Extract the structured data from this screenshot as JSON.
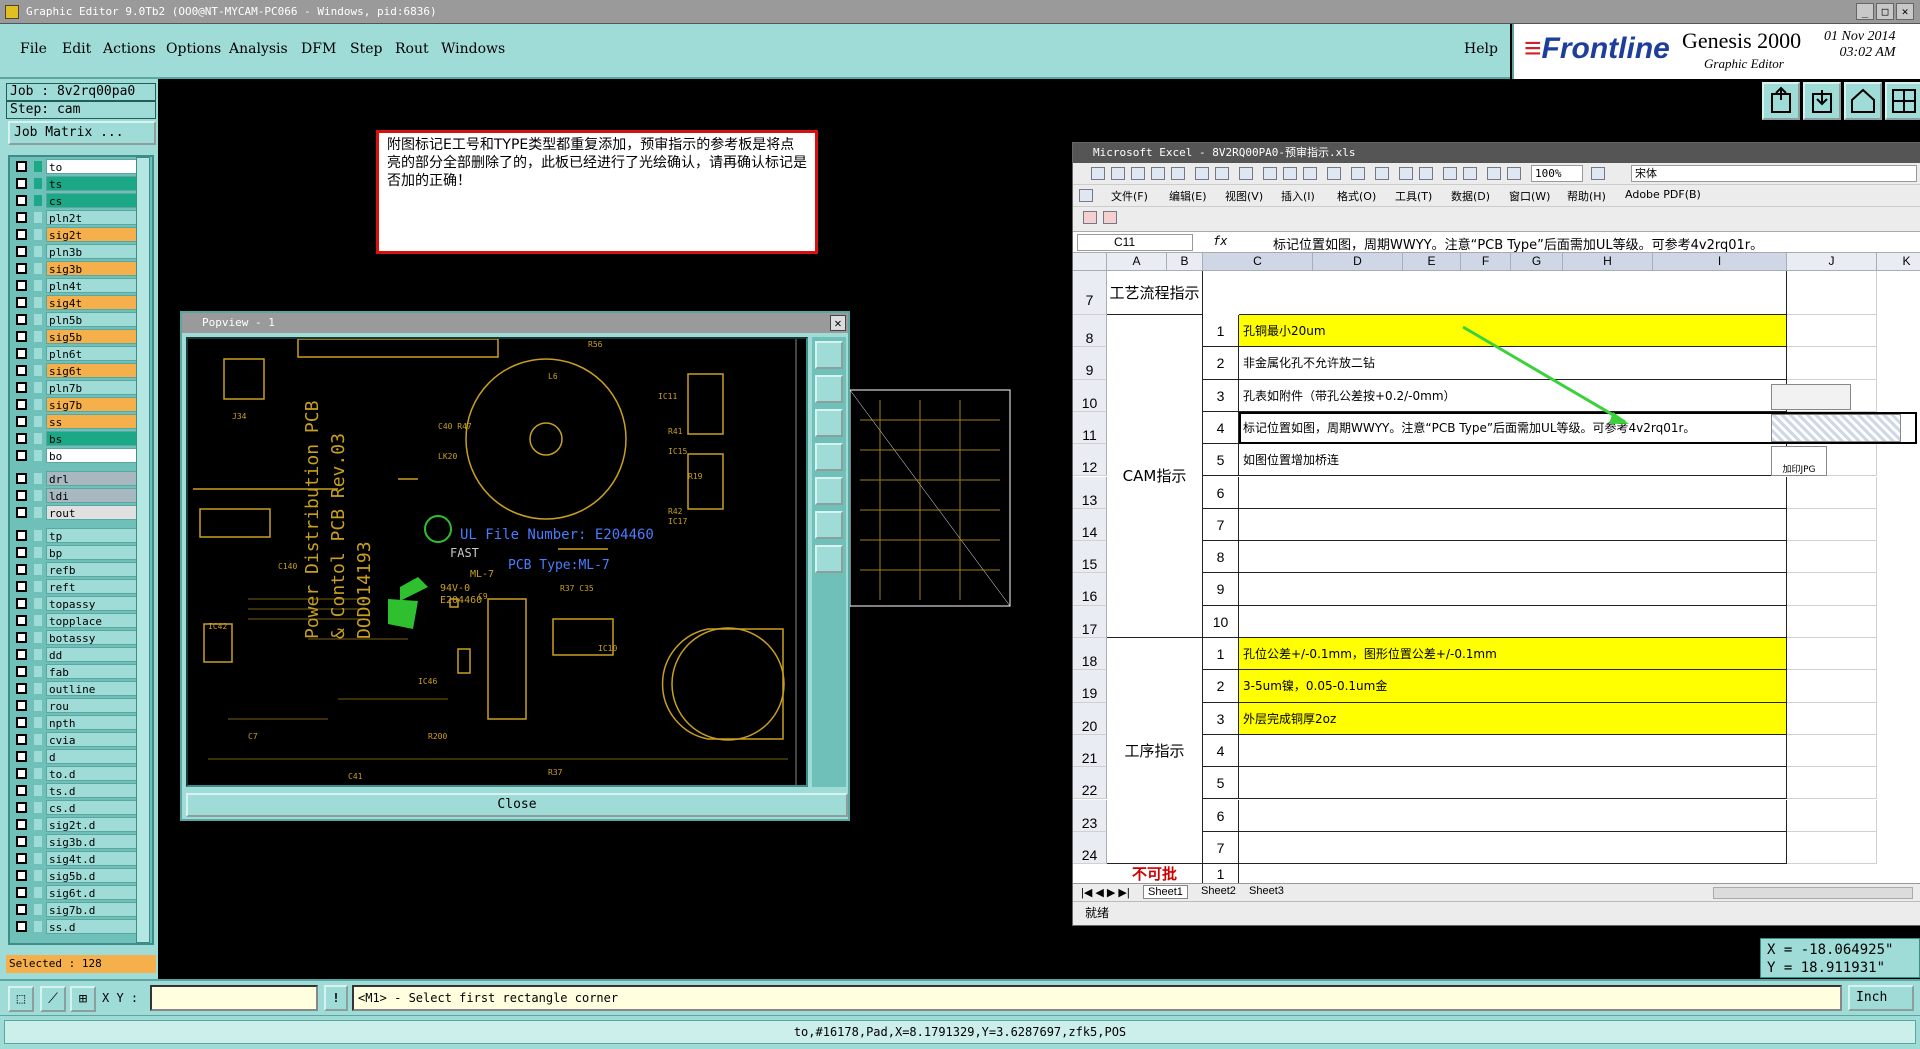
{
  "window": {
    "title": "Graphic Editor 9.0Tb2 (OO0@NT-MYCAM-PC066 - Windows, pid:6836)"
  },
  "menu": {
    "items": [
      "File",
      "Edit",
      "Actions",
      "Options",
      "Analysis",
      "DFM",
      "Step",
      "Rout",
      "Windows"
    ],
    "help": "Help"
  },
  "brand": {
    "logo": "Frontline",
    "product": "Genesis 2000",
    "subtitle": "Graphic Editor",
    "date": "01 Nov 2014",
    "time": "03:02 AM"
  },
  "job": {
    "job_label": "Job : 8v2rq00pa0",
    "step_label": "Step: cam",
    "matrix_button": "Job Matrix ..."
  },
  "layers": [
    {
      "name": "to",
      "color": "#ffffff"
    },
    {
      "name": "ts",
      "color": "#1aa887"
    },
    {
      "name": "cs",
      "color": "#1aa887"
    },
    {
      "name": "pln2t",
      "color": "#9fdcd7"
    },
    {
      "name": "sig2t",
      "color": "#f5b04c"
    },
    {
      "name": "pln3b",
      "color": "#9fdcd7"
    },
    {
      "name": "sig3b",
      "color": "#f5b04c"
    },
    {
      "name": "pln4t",
      "color": "#9fdcd7"
    },
    {
      "name": "sig4t",
      "color": "#f5b04c"
    },
    {
      "name": "pln5b",
      "color": "#9fdcd7"
    },
    {
      "name": "sig5b",
      "color": "#f5b04c"
    },
    {
      "name": "pln6t",
      "color": "#9fdcd7"
    },
    {
      "name": "sig6t",
      "color": "#f5b04c"
    },
    {
      "name": "pln7b",
      "color": "#9fdcd7"
    },
    {
      "name": "sig7b",
      "color": "#f5b04c"
    },
    {
      "name": "ss",
      "color": "#f5b04c"
    },
    {
      "name": "bs",
      "color": "#1aa887"
    },
    {
      "name": "bo",
      "color": "#ffffff"
    },
    {
      "name": "drl",
      "color": "#a9b8c0"
    },
    {
      "name": "ldi",
      "color": "#a9b8c0"
    },
    {
      "name": "rout",
      "color": "#e0e0e0"
    },
    {
      "name": "tp",
      "color": "#9fdcd7"
    },
    {
      "name": "bp",
      "color": "#9fdcd7"
    },
    {
      "name": "refb",
      "color": "#9fdcd7"
    },
    {
      "name": "reft",
      "color": "#9fdcd7"
    },
    {
      "name": "topassy",
      "color": "#9fdcd7"
    },
    {
      "name": "topplace",
      "color": "#9fdcd7"
    },
    {
      "name": "botassy",
      "color": "#9fdcd7"
    },
    {
      "name": "dd",
      "color": "#9fdcd7"
    },
    {
      "name": "fab",
      "color": "#9fdcd7"
    },
    {
      "name": "outline",
      "color": "#9fdcd7"
    },
    {
      "name": "rou",
      "color": "#9fdcd7"
    },
    {
      "name": "npth",
      "color": "#9fdcd7"
    },
    {
      "name": "cvia",
      "color": "#9fdcd7"
    },
    {
      "name": "d",
      "color": "#9fdcd7"
    },
    {
      "name": "to.d",
      "color": "#9fdcd7"
    },
    {
      "name": "ts.d",
      "color": "#9fdcd7"
    },
    {
      "name": "cs.d",
      "color": "#9fdcd7"
    },
    {
      "name": "sig2t.d",
      "color": "#9fdcd7"
    },
    {
      "name": "sig3b.d",
      "color": "#9fdcd7"
    },
    {
      "name": "sig4t.d",
      "color": "#9fdcd7"
    },
    {
      "name": "sig5b.d",
      "color": "#9fdcd7"
    },
    {
      "name": "sig6t.d",
      "color": "#9fdcd7"
    },
    {
      "name": "sig7b.d",
      "color": "#9fdcd7"
    },
    {
      "name": "ss.d",
      "color": "#9fdcd7"
    }
  ],
  "selected": "Selected : 128",
  "note": "附图标记E工号和TYPE类型都重复添加，预审指示的参考板是将点亮的部分全部删除了的，此板已经进行了光绘确认，请再确认标记是否加的正确！",
  "popview": {
    "title": "Popview - 1",
    "close": "Close",
    "pcb_text": {
      "ul_file": "UL File Number: E204460",
      "pcb_type": "PCB Type:ML-7",
      "fast": "FAST",
      "ml7": "ML-7",
      "v0": "94V-0",
      "e204460": "E204460",
      "board_line1": "Power Distribution PCB",
      "board_line2": "& Contol PCB  Rev.03",
      "board_line3": "DOD014193"
    }
  },
  "excel": {
    "title": "Microsoft Excel - 8V2RQ00PA0-预审指示.xls",
    "menu": [
      "文件(F)",
      "编辑(E)",
      "视图(V)",
      "插入(I)",
      "格式(O)",
      "工具(T)",
      "数据(D)",
      "窗口(W)",
      "帮助(H)",
      "Adobe PDF(B)"
    ],
    "zoom": "100%",
    "font": "宋体",
    "namebox": "C11",
    "fx": "fx",
    "formula": "标记位置如图，周期WWYY。注意“PCB Type”后面需加UL等级。可参考4v2rq01r。",
    "columns": [
      "A",
      "B",
      "C",
      "D",
      "E",
      "F",
      "G",
      "H",
      "I",
      "J",
      "K"
    ],
    "rows": [
      {
        "n": "7",
        "b": "",
        "c": ""
      },
      {
        "n": "8",
        "b": "1",
        "c": "孔铜最小20um"
      },
      {
        "n": "9",
        "b": "2",
        "c": "非金属化孔不允许放二钻"
      },
      {
        "n": "10",
        "b": "3",
        "c": "孔表如附件（带孔公差按+0.2/-0mm）"
      },
      {
        "n": "11",
        "b": "4",
        "c": "标记位置如图，周期WWYY。注意“PCB Type”后面需加UL等级。可参考4v2rq01r。"
      },
      {
        "n": "12",
        "b": "5",
        "c": "如图位置增加桥连"
      },
      {
        "n": "13",
        "b": "6",
        "c": ""
      },
      {
        "n": "14",
        "b": "7",
        "c": ""
      },
      {
        "n": "15",
        "b": "8",
        "c": ""
      },
      {
        "n": "16",
        "b": "9",
        "c": ""
      },
      {
        "n": "17",
        "b": "10",
        "c": ""
      },
      {
        "n": "18",
        "b": "1",
        "c": "孔位公差+/-0.1mm，图形位置公差+/-0.1mm"
      },
      {
        "n": "19",
        "b": "2",
        "c": "3-5um镍，0.05-0.1um金"
      },
      {
        "n": "20",
        "b": "3",
        "c": "外层完成铜厚2oz"
      },
      {
        "n": "21",
        "b": "4",
        "c": ""
      },
      {
        "n": "22",
        "b": "5",
        "c": ""
      },
      {
        "n": "23",
        "b": "6",
        "c": ""
      },
      {
        "n": "24",
        "b": "7",
        "c": ""
      }
    ],
    "a_labels": {
      "process": "工艺流程指示",
      "cam": "CAM指示",
      "proc": "工序指示",
      "bad": "不可批"
    },
    "last_row_b": "1",
    "attachment": "加印JPG",
    "sheets": [
      "Sheet1",
      "Sheet2",
      "Sheet3"
    ],
    "status": "就绪"
  },
  "coords": {
    "x": "X = -18.064925\"",
    "y": "Y = 18.911931\""
  },
  "cmd": {
    "xy_label": "X Y :",
    "bang": "!",
    "prompt": "<M1> - Select first rectangle corner",
    "unit": "Inch"
  },
  "status": "to,#16178,Pad,X=8.1791329,Y=3.6287697,zfk5,POS"
}
